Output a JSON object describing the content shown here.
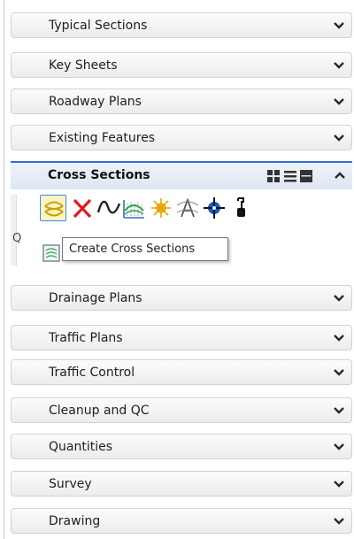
{
  "panels_top": [
    {
      "label": "Typical Sections"
    },
    {
      "label": "Key Sheets"
    },
    {
      "label": "Roadway Plans"
    },
    {
      "label": "Existing Features"
    }
  ],
  "active_panel": {
    "label": "Cross Sections",
    "view_icons": [
      "grid-view-icon",
      "list-view-icon",
      "large-view-icon"
    ],
    "collapse_icon": "chevron-up-icon",
    "group_label": "Q",
    "tools": [
      "create-cross-sections-icon",
      "delete-icon",
      "wave-tool-icon",
      "cross-section-grid-icon",
      "star-burst-icon",
      "text-a-icon",
      "target-crosshair-icon",
      "probe-icon"
    ],
    "tooltip": "Create Cross Sections"
  },
  "panels_bottom": [
    {
      "label": "Drainage Plans"
    },
    {
      "label": "Traffic Plans"
    },
    {
      "label": "Traffic Control"
    },
    {
      "label": "Cleanup and QC"
    },
    {
      "label": "Quantities"
    },
    {
      "label": "Survey"
    },
    {
      "label": "Drawing"
    }
  ],
  "colors": {
    "accent": "#2b6fcf",
    "selected_bg": "#fff3c4",
    "delete_red": "#e11b1b"
  }
}
